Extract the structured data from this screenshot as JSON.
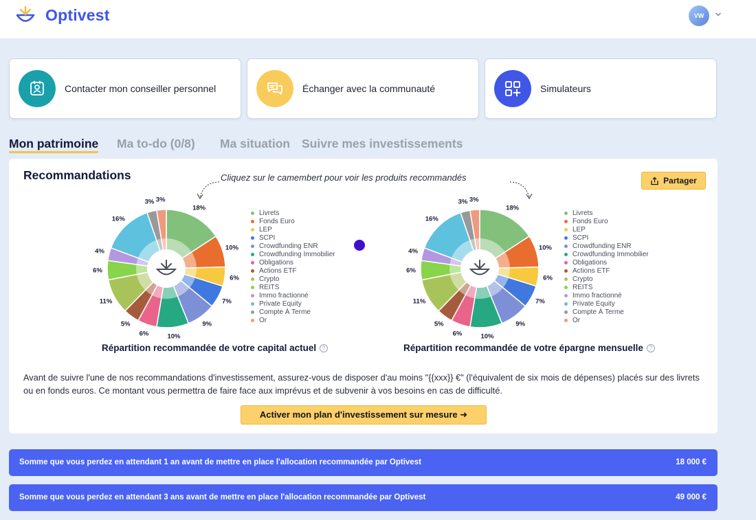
{
  "brand": {
    "name": "Optivest"
  },
  "user": {
    "initials": "VW"
  },
  "quick_actions": [
    {
      "label": "Contacter mon conseiller personnel",
      "icon": "contact-card-icon",
      "color": "#1aa0ab"
    },
    {
      "label": "Échanger avec la communauté",
      "icon": "chat-bubbles-icon",
      "color": "#f9cb5b"
    },
    {
      "label": "Simulateurs",
      "icon": "apps-add-icon",
      "color": "#3f56e6"
    }
  ],
  "tabs": [
    {
      "label": "Mon patrimoine",
      "active": true
    },
    {
      "label": "Ma to-do (0/8)",
      "active": false
    },
    {
      "label": "Ma situation",
      "active": false
    },
    {
      "label": "Suivre mes investissements",
      "active": false
    }
  ],
  "recommendations": {
    "title": "Recommandations",
    "hint": "Cliquez sur le camembert pour voir les produits recommandés",
    "share_label": "Partager",
    "charts": [
      {
        "caption": "Répartition recommandée de votre capital actuel"
      },
      {
        "caption": "Répartition recommandée de votre épargne mensuelle"
      }
    ],
    "legend": [
      {
        "label": "Livrets",
        "color": "#82c07b"
      },
      {
        "label": "Fonds Euro",
        "color": "#e96d2f"
      },
      {
        "label": "LEP",
        "color": "#f7c93f"
      },
      {
        "label": "SCPI",
        "color": "#3f78de"
      },
      {
        "label": "Crowdfunding ENR",
        "color": "#7d8fd6"
      },
      {
        "label": "Crowdfunding Immobilier",
        "color": "#26a982"
      },
      {
        "label": "Obligations",
        "color": "#e8648a"
      },
      {
        "label": "Actions ETF",
        "color": "#a75b3d"
      },
      {
        "label": "Crypto",
        "color": "#a9c35b"
      },
      {
        "label": "REITS",
        "color": "#88d44a"
      },
      {
        "label": "Immo fractionné",
        "color": "#b397e0"
      },
      {
        "label": "Private Equity",
        "color": "#5ec1de"
      },
      {
        "label": "Compte À Terme",
        "color": "#999999"
      },
      {
        "label": "Or",
        "color": "#ee9a7e"
      }
    ],
    "disclaimer": "Avant de suivre l'une de nos recommandations d'investissement, assurez-vous de disposer d'au moins \"{{xxx}} €\" (l'équivalent de six mois de dépenses) placés sur des livrets ou en fonds euros. Ce montant vous permettra de faire face aux imprévus et de subvenir à vos besoins en cas de difficulté.",
    "cta_label": "Activer mon plan d'investissement sur mesure ➜"
  },
  "chart_data": [
    {
      "type": "pie",
      "title": "Répartition recommandée de votre capital actuel",
      "categories": [
        "Livrets",
        "Fonds Euro",
        "LEP",
        "SCPI",
        "Crowdfunding ENR",
        "Crowdfunding Immobilier",
        "Obligations",
        "Actions ETF",
        "Crypto",
        "REITS",
        "Immo fractionné",
        "Private Equity",
        "Compte À Terme",
        "Or"
      ],
      "values": [
        18,
        10,
        6,
        7,
        9,
        10,
        6,
        5,
        11,
        6,
        4,
        16,
        3,
        3
      ],
      "unit": "%",
      "legend": "right"
    },
    {
      "type": "pie",
      "title": "Répartition recommandée de votre épargne mensuelle",
      "categories": [
        "Livrets",
        "Fonds Euro",
        "LEP",
        "SCPI",
        "Crowdfunding ENR",
        "Crowdfunding Immobilier",
        "Obligations",
        "Actions ETF",
        "Crypto",
        "REITS",
        "Immo fractionné",
        "Private Equity",
        "Compte À Terme",
        "Or"
      ],
      "values": [
        18,
        10,
        6,
        7,
        9,
        10,
        6,
        5,
        11,
        6,
        4,
        16,
        3,
        3
      ],
      "unit": "%",
      "legend": "right"
    }
  ],
  "losses": [
    {
      "label": "Somme que vous perdez en attendant 1 an avant de mettre en place l'allocation recommandée par Optivest",
      "amount": "18 000 €"
    },
    {
      "label": "Somme que vous perdez en attendant 3 ans avant de mettre en place l'allocation recommandée par Optivest",
      "amount": "49 000 €"
    }
  ]
}
